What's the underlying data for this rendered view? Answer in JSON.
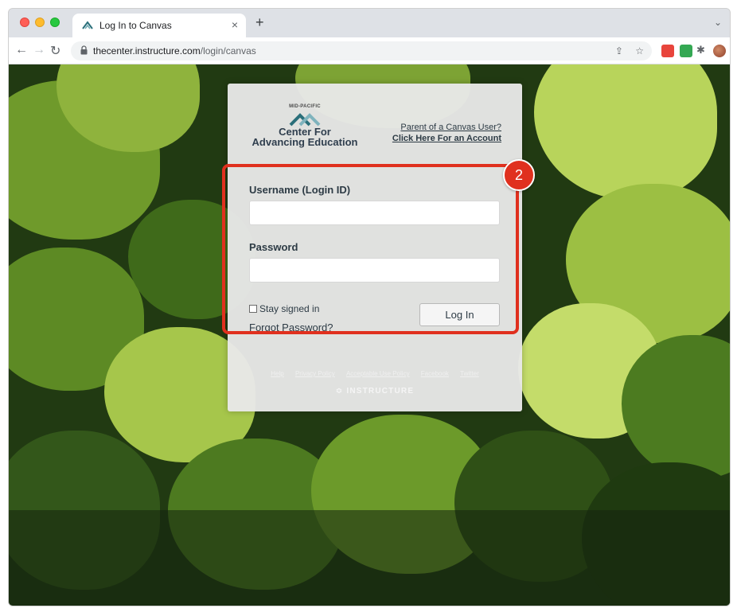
{
  "browser": {
    "tab_title": "Log In to Canvas",
    "tab_close": "×",
    "new_tab": "+",
    "tab_search": "⌄",
    "url_host": "thecenter.instructure.com",
    "url_path": "/login/canvas",
    "nav_back": "←",
    "nav_forward": "→",
    "nav_reload": "↻",
    "share_icon": "⇪",
    "bookmark_icon": "☆",
    "menu": "⋮"
  },
  "login": {
    "logo_small": "MID-PACIFIC",
    "logo_line1": "Center For",
    "logo_line2": "Advancing Education",
    "parent_line1": "Parent of a Canvas User?",
    "parent_line2": "Click Here For an Account",
    "username_label": "Username (Login ID)",
    "username_value": "",
    "password_label": "Password",
    "password_value": "",
    "stay_signed_in": "Stay signed in",
    "forgot_password": "Forgot Password?",
    "login_button": "Log In",
    "footer_links": [
      "Help",
      "Privacy Policy",
      "Acceptable Use Policy",
      "Facebook",
      "Twitter"
    ],
    "footer_brand": "≎ INSTRUCTURE"
  },
  "annotation": {
    "step": "2",
    "color": "#e0301e"
  },
  "colors": {
    "text_dark": "#2d3b45",
    "card_bg": "#e8e8e8"
  }
}
